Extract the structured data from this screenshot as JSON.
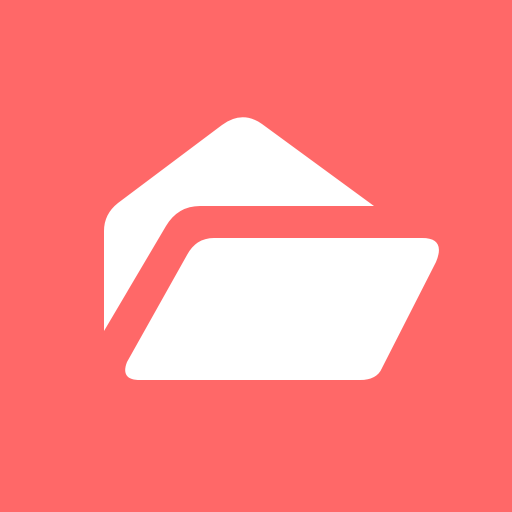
{
  "icon": {
    "name": "open-folder-icon",
    "background_color": "#FF6868",
    "foreground_color": "#FFFFFF"
  }
}
